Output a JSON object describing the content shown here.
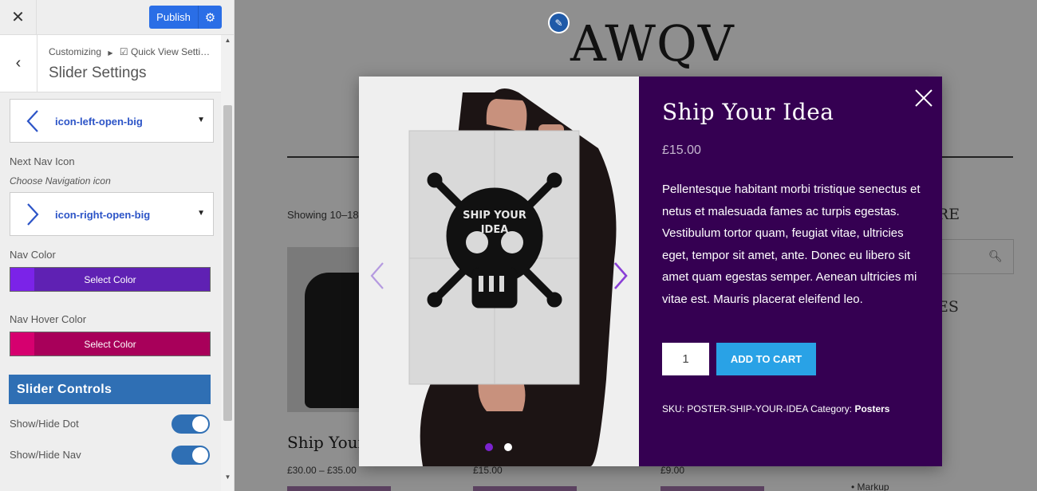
{
  "header": {
    "close_icon": "close-icon",
    "publish_label": "Publish",
    "settings_icon": "gear-icon"
  },
  "panel": {
    "breadcrumb_root": "Customizing",
    "breadcrumb_current": "☑ Quick View Setti…",
    "section_title": "Slider Settings"
  },
  "fields": {
    "prev_icon_value": "icon-left-open-big",
    "next_nav_label": "Next Nav Icon",
    "next_nav_desc": "Choose Navigation icon",
    "next_icon_value": "icon-right-open-big",
    "nav_color_label": "Nav Color",
    "nav_color_button": "Select Color",
    "nav_color_value": "#7b23cf",
    "nav_hover_label": "Nav Hover Color",
    "nav_hover_button": "Select Color",
    "nav_hover_value": "#c2005c"
  },
  "slider_controls": {
    "heading": "Slider Controls",
    "show_dot_label": "Show/Hide Dot",
    "show_dot_on": true,
    "show_nav_label": "Show/Hide Nav",
    "show_nav_on": true
  },
  "preview": {
    "site_title": "AWQV",
    "showing_text": "Showing 10–18",
    "widget_title_1": "RE",
    "widget_title_2": "ES",
    "product_name_partial": "Ship Your",
    "price_1": "£30.00 – £35.00",
    "price_2": "£15.00",
    "price_3": "£9.00",
    "markup_text": "Markup"
  },
  "quick_view": {
    "title": "Ship Your Idea",
    "price": "£15.00",
    "description": "Pellentesque habitant morbi tristique senectus et netus et malesuada fames ac turpis egestas. Vestibulum tortor quam, feugiat vitae, ultricies eget, tempor sit amet, ante. Donec eu libero sit amet quam egestas semper. Aenean ultricies mi vitae est. Mauris placerat eleifend leo.",
    "quantity": "1",
    "add_to_cart": "ADD TO CART",
    "sku_label": "SKU:",
    "sku": "POSTER-SHIP-YOUR-IDEA",
    "category_label": "Category:",
    "category": "Posters",
    "poster_text": "SHIP YOUR IDEA",
    "slides": 2,
    "active_slide": 1
  },
  "colors": {
    "modal_panel": "#350052",
    "accent_blue": "#29a2e6",
    "nav_arrow": "#8a3fd6",
    "dot_active": "#7b23cf",
    "dot_inactive": "#ffffff"
  }
}
